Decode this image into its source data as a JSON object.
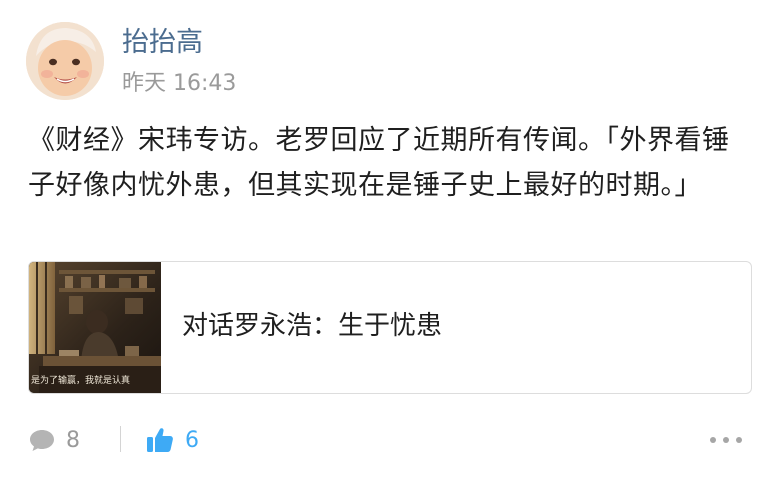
{
  "post": {
    "username": "抬抬高",
    "timestamp": "昨天 16:43",
    "text": "《财经》宋玮专访。老罗回应了近期所有传闻。「外界看锤子好像内忧外患，但其实现在是锤子史上最好的时期。」",
    "link_card": {
      "title": "对话罗永浩：生于忧患",
      "thumbnail_caption": "是为了输赢，我就是认真"
    },
    "actions": {
      "comment_count": "8",
      "like_count": "6"
    }
  },
  "colors": {
    "username": "#4b6c8f",
    "timestamp": "#9a9a9a",
    "like_accent": "#3eaaf5",
    "muted_icon": "#b4b4b4"
  },
  "icons": {
    "comment": "speech-bubble",
    "like": "thumbs-up",
    "more": "ellipsis-horizontal"
  }
}
